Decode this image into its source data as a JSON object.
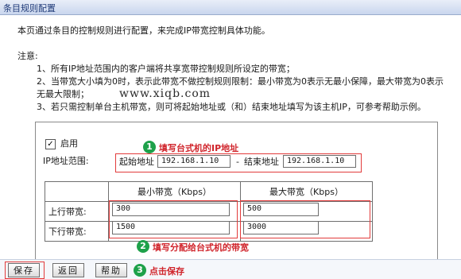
{
  "title": "条目规则配置",
  "intro": "本页通过条目的控制规则进行配置，来完成IP带宽控制具体功能。",
  "notes": {
    "label": "注意:",
    "line1": "1、所有IP地址范围内的客户端将共享宽带控制规则所设定的带宽；",
    "line2": "2、当带宽大小填为0时，表示此带宽不做控制规则限制：最小带宽为0表示无最小保障，最大带宽为0表示",
    "line2b": "无最大限制；",
    "line3": "3、若只需控制单台主机带宽，则可将起始地址或（和）结束地址填写为该主机IP，可参考帮助示例。"
  },
  "watermark": "www.xiqb.com",
  "enable": {
    "checked": "✓",
    "label": "启用"
  },
  "ip_range": {
    "label": "IP地址范围:",
    "start_label": "起始地址",
    "start_value": "192.168.1.10",
    "separator": "-",
    "end_label": "结束地址",
    "end_value": "192.168.1.10"
  },
  "bandwidth": {
    "min_header": "最小带宽（Kbps）",
    "max_header": "最大带宽（Kbps）",
    "rows": [
      {
        "label": "上行带宽:",
        "min": "300",
        "max": "500"
      },
      {
        "label": "下行带宽:",
        "min": "1500",
        "max": "3000"
      }
    ]
  },
  "annotations": [
    {
      "num": "1",
      "text": "填写台式机的IP地址"
    },
    {
      "num": "2",
      "text": "填写分配给台式机的带宽"
    },
    {
      "num": "3",
      "text": "点击保存"
    }
  ],
  "buttons": {
    "save": "保存",
    "back": "返回",
    "help": "帮助"
  },
  "colors": {
    "annotation_red": "#d0242b",
    "badge_green": "#1ea14a",
    "title_blue": "#1f3a78"
  }
}
